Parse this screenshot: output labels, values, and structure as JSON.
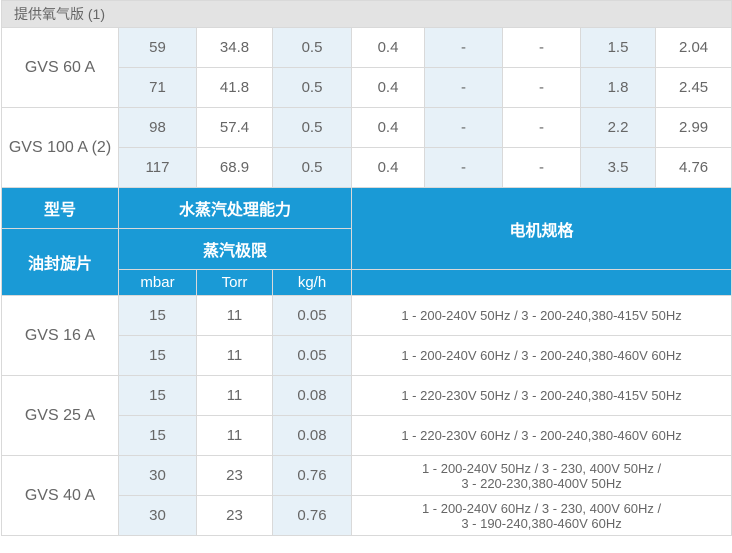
{
  "section_band": "提供氧气版 (1)",
  "upper_rows": [
    {
      "model": "GVS 60 A",
      "rows": [
        [
          "59",
          "34.8",
          "0.5",
          "0.4",
          "-",
          "-",
          "1.5",
          "2.04"
        ],
        [
          "71",
          "41.8",
          "0.5",
          "0.4",
          "-",
          "-",
          "1.8",
          "2.45"
        ]
      ]
    },
    {
      "model": "GVS 100 A (2)",
      "rows": [
        [
          "98",
          "57.4",
          "0.5",
          "0.4",
          "-",
          "-",
          "2.2",
          "2.99"
        ],
        [
          "117",
          "68.9",
          "0.5",
          "0.4",
          "-",
          "-",
          "3.5",
          "4.76"
        ]
      ]
    }
  ],
  "header": {
    "model": "型号",
    "pump_type": "油封旋片",
    "vapor_capacity": "水蒸汽处理能力",
    "vapor_limit": "蒸汽极限",
    "motor_spec": "电机规格",
    "unit_mbar": "mbar",
    "unit_torr": "Torr",
    "unit_kgh": "kg/h"
  },
  "lower_rows": [
    {
      "model": "GVS 16 A",
      "rows": [
        {
          "mbar": "15",
          "torr": "11",
          "kgh": "0.05",
          "motor": [
            "1 - 200-240V 50Hz / 3 - 200-240,380-415V 50Hz"
          ]
        },
        {
          "mbar": "15",
          "torr": "11",
          "kgh": "0.05",
          "motor": [
            "1 - 200-240V 60Hz / 3 - 200-240,380-460V 60Hz"
          ]
        }
      ]
    },
    {
      "model": "GVS 25 A",
      "rows": [
        {
          "mbar": "15",
          "torr": "11",
          "kgh": "0.08",
          "motor": [
            "1 - 220-230V 50Hz / 3 - 200-240,380-415V 50Hz"
          ]
        },
        {
          "mbar": "15",
          "torr": "11",
          "kgh": "0.08",
          "motor": [
            "1 - 220-230V 60Hz / 3 - 200-240,380-460V 60Hz"
          ]
        }
      ]
    },
    {
      "model": "GVS 40 A",
      "rows": [
        {
          "mbar": "30",
          "torr": "23",
          "kgh": "0.76",
          "motor": [
            "1 - 200-240V 50Hz / 3 - 230, 400V 50Hz /",
            "3 - 220-230,380-400V 50Hz"
          ]
        },
        {
          "mbar": "30",
          "torr": "23",
          "kgh": "0.76",
          "motor": [
            "1 - 200-240V 60Hz / 3 - 230, 400V 60Hz /",
            "3 - 190-240,380-460V 60Hz"
          ]
        }
      ]
    }
  ]
}
